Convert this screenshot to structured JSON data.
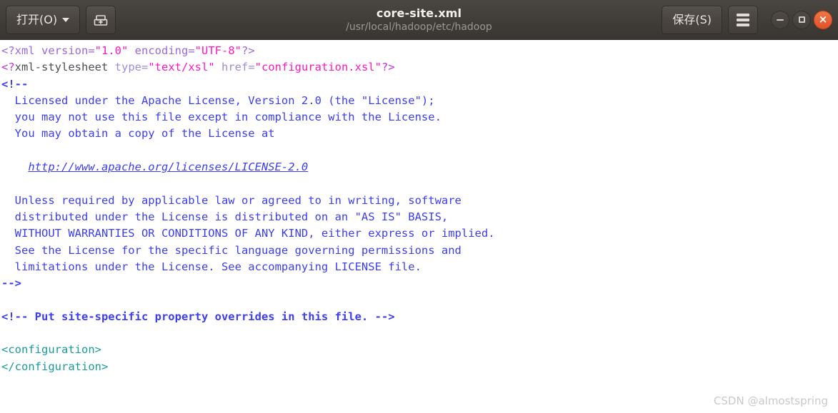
{
  "window": {
    "title": "core-site.xml",
    "subtitle": "/usr/local/hadoop/etc/hadoop",
    "open_button_label": "打开(O)",
    "save_button_label": "保存(S)",
    "saveas_icon": "save-as-icon",
    "menu_icon": "hamburger-menu-icon",
    "minimize_icon": "minimize-icon",
    "maximize_icon": "maximize-icon",
    "close_icon": "close-icon",
    "close_glyph": "×",
    "colors": {
      "titlebar_bg": "#403c38",
      "close_button": "#e2512a",
      "comment_blue": "#3c3ef0",
      "string_magenta": "#ff17c4",
      "tag_teal": "#1a9b9b",
      "attr_lavender": "#9b8fd6",
      "pi_purple": "#9b6ad6",
      "editor_bg": "#ffffff"
    }
  },
  "editor": {
    "lines": [
      {
        "id": "l1",
        "segments": [
          {
            "cls": "t-pi",
            "text": "<?xml version="
          },
          {
            "cls": "t-str",
            "text": "\"1.0\""
          },
          {
            "cls": "t-pi",
            "text": " encoding="
          },
          {
            "cls": "t-str",
            "text": "\"UTF-8\""
          },
          {
            "cls": "t-pi",
            "text": "?>"
          }
        ]
      },
      {
        "id": "l2",
        "segments": [
          {
            "cls": "t-pipink",
            "text": "<?"
          },
          {
            "cls": "t-pidark",
            "text": "xml-stylesheet "
          },
          {
            "cls": "t-attr",
            "text": "type="
          },
          {
            "cls": "t-str",
            "text": "\"text/xsl\""
          },
          {
            "cls": "t-attr",
            "text": " href="
          },
          {
            "cls": "t-str",
            "text": "\"configuration.xsl\""
          },
          {
            "cls": "t-pipink",
            "text": "?>"
          }
        ]
      },
      {
        "id": "l3",
        "segments": [
          {
            "cls": "t-commentb",
            "text": "<!--"
          }
        ]
      },
      {
        "id": "l4",
        "segments": [
          {
            "cls": "t-comment",
            "text": "  Licensed under the Apache License, Version 2.0 (the \"License\");"
          }
        ]
      },
      {
        "id": "l5",
        "segments": [
          {
            "cls": "t-comment",
            "text": "  you may not use this file except in compliance with the License."
          }
        ]
      },
      {
        "id": "l6",
        "segments": [
          {
            "cls": "t-comment",
            "text": "  You may obtain a copy of the License at"
          }
        ]
      },
      {
        "id": "l7",
        "segments": [
          {
            "cls": "t-comment",
            "text": ""
          }
        ]
      },
      {
        "id": "l8",
        "segments": [
          {
            "cls": "t-comment",
            "text": "    "
          },
          {
            "cls": "t-url",
            "text": "http://www.apache.org/licenses/LICENSE-2.0"
          }
        ]
      },
      {
        "id": "l9",
        "segments": [
          {
            "cls": "t-comment",
            "text": ""
          }
        ]
      },
      {
        "id": "l10",
        "segments": [
          {
            "cls": "t-comment",
            "text": "  Unless required by applicable law or agreed to in writing, software"
          }
        ]
      },
      {
        "id": "l11",
        "segments": [
          {
            "cls": "t-comment",
            "text": "  distributed under the License is distributed on an \"AS IS\" BASIS,"
          }
        ]
      },
      {
        "id": "l12",
        "segments": [
          {
            "cls": "t-comment",
            "text": "  WITHOUT WARRANTIES OR CONDITIONS OF ANY KIND, either express or implied."
          }
        ]
      },
      {
        "id": "l13",
        "segments": [
          {
            "cls": "t-comment",
            "text": "  See the License for the specific language governing permissions and"
          }
        ]
      },
      {
        "id": "l14",
        "segments": [
          {
            "cls": "t-comment",
            "text": "  limitations under the License. See accompanying LICENSE file."
          }
        ]
      },
      {
        "id": "l15",
        "segments": [
          {
            "cls": "t-commentb",
            "text": "-->"
          }
        ]
      },
      {
        "id": "l16",
        "segments": [
          {
            "cls": "t-comment",
            "text": ""
          }
        ]
      },
      {
        "id": "l17",
        "segments": [
          {
            "cls": "t-commentb",
            "text": "<!-- Put site-specific property overrides in this file. -->"
          }
        ]
      },
      {
        "id": "l18",
        "segments": [
          {
            "cls": "t-comment",
            "text": ""
          }
        ]
      },
      {
        "id": "l19",
        "segments": [
          {
            "cls": "t-tag",
            "text": "<configuration>"
          }
        ]
      },
      {
        "id": "l20",
        "segments": [
          {
            "cls": "t-tag",
            "text": "</configuration>"
          }
        ]
      }
    ]
  },
  "watermark": {
    "text": "CSDN @almostspring"
  }
}
